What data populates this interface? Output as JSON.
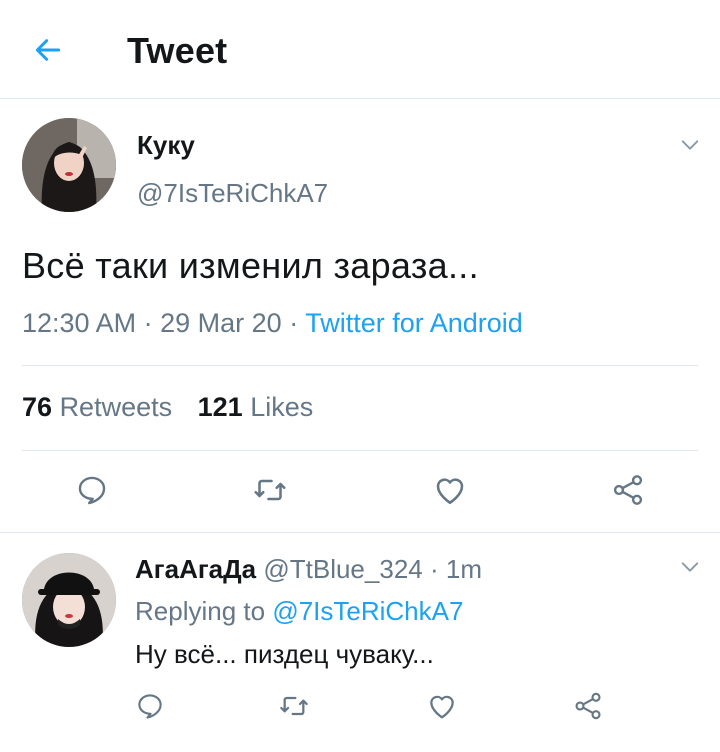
{
  "header": {
    "back_icon": "arrow-left-icon",
    "title": "Tweet"
  },
  "tweet": {
    "display_name": "Куку",
    "handle": "@7IsTeRiChkA7",
    "text": "Всё таки изменил зараза...",
    "time": "12:30 AM",
    "separator": "·",
    "date": "29 Mar 20",
    "source": "Twitter for Android",
    "retweets_count": "76",
    "retweets_label": "Retweets",
    "likes_count": "121",
    "likes_label": "Likes",
    "actions": [
      "reply-icon",
      "retweet-icon",
      "heart-icon",
      "share-icon"
    ]
  },
  "reply": {
    "display_name": "АгаАгаДа",
    "handle": "@TtBlue_324",
    "separator": "·",
    "time": "1m",
    "replying_label": "Replying to",
    "replying_to": "@7IsTeRiChkA7",
    "text": "Ну всё... пиздец чуваку..."
  },
  "colors": {
    "accent": "#1da1f2",
    "secondary_text": "#657786",
    "primary_text": "#14171a",
    "divider": "#e1e8ed"
  }
}
